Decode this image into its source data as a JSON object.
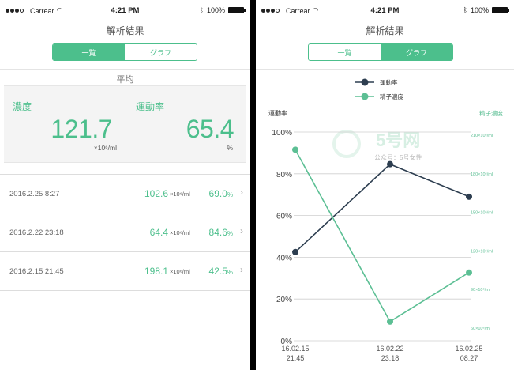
{
  "status": {
    "carrier": "Carrear",
    "time": "4:21 PM",
    "battery": "100%"
  },
  "nav": {
    "title": "解析結果"
  },
  "segment": {
    "list_label": "一覧",
    "graph_label": "グラフ"
  },
  "average": {
    "title": "平均",
    "concentration_label": "濃度",
    "concentration_value": "121.7",
    "concentration_unit": "×10⁶/ml",
    "motility_label": "運動率",
    "motility_value": "65.4",
    "motility_unit": "%"
  },
  "records": [
    {
      "date": "2016.2.25 8:27",
      "concentration": "102.6",
      "unit": "×10⁶/ml",
      "motility": "69.0",
      "motility_unit": "%"
    },
    {
      "date": "2016.2.22 23:18",
      "concentration": "64.4",
      "unit": "×10⁶/ml",
      "motility": "84.6",
      "motility_unit": "%"
    },
    {
      "date": "2016.2.15 21:45",
      "concentration": "198.1",
      "unit": "×10⁶/ml",
      "motility": "42.5",
      "motility_unit": "%"
    }
  ],
  "watermark": {
    "logo_text": "5号网",
    "subtitle": "公众号：5号女性"
  },
  "chart_data": {
    "type": "line",
    "x": [
      "16.02.15 21:45",
      "16.02.22 23:18",
      "16.02.25 08:27"
    ],
    "x_labels": [
      [
        "16.02.15",
        "21:45"
      ],
      [
        "16.02.22",
        "23:18"
      ],
      [
        "16.02.25",
        "08:27"
      ]
    ],
    "ylabel": "運動率",
    "ylabel_right": "精子濃度",
    "ylim": [
      0,
      100
    ],
    "y_ticks": [
      "100%",
      "80%",
      "60%",
      "40%",
      "20%",
      "0%"
    ],
    "y_tick_values": [
      100,
      80,
      60,
      40,
      20,
      0
    ],
    "ylim_right": [
      40,
      220
    ],
    "y_ticks_right": [
      "210×10⁶/ml",
      "180×10⁶/ml",
      "150×10⁶/ml",
      "120×10⁶/ml",
      "90×10⁶/ml",
      "60×10⁶/ml"
    ],
    "y_tick_values_right": [
      210,
      180,
      150,
      120,
      90,
      60
    ],
    "grid": true,
    "legend": "top-center",
    "series": [
      {
        "name": "運動率",
        "axis": "left",
        "color": "#2d3e50",
        "values": [
          42.5,
          84.6,
          69.0
        ]
      },
      {
        "name": "精子濃度",
        "axis": "right",
        "color": "#5cbf94",
        "values": [
          198.1,
          64.4,
          102.6
        ]
      }
    ]
  },
  "colors": {
    "accent": "#4cbf8c",
    "dark_series": "#2d3e50",
    "light_series": "#5cbf94"
  }
}
